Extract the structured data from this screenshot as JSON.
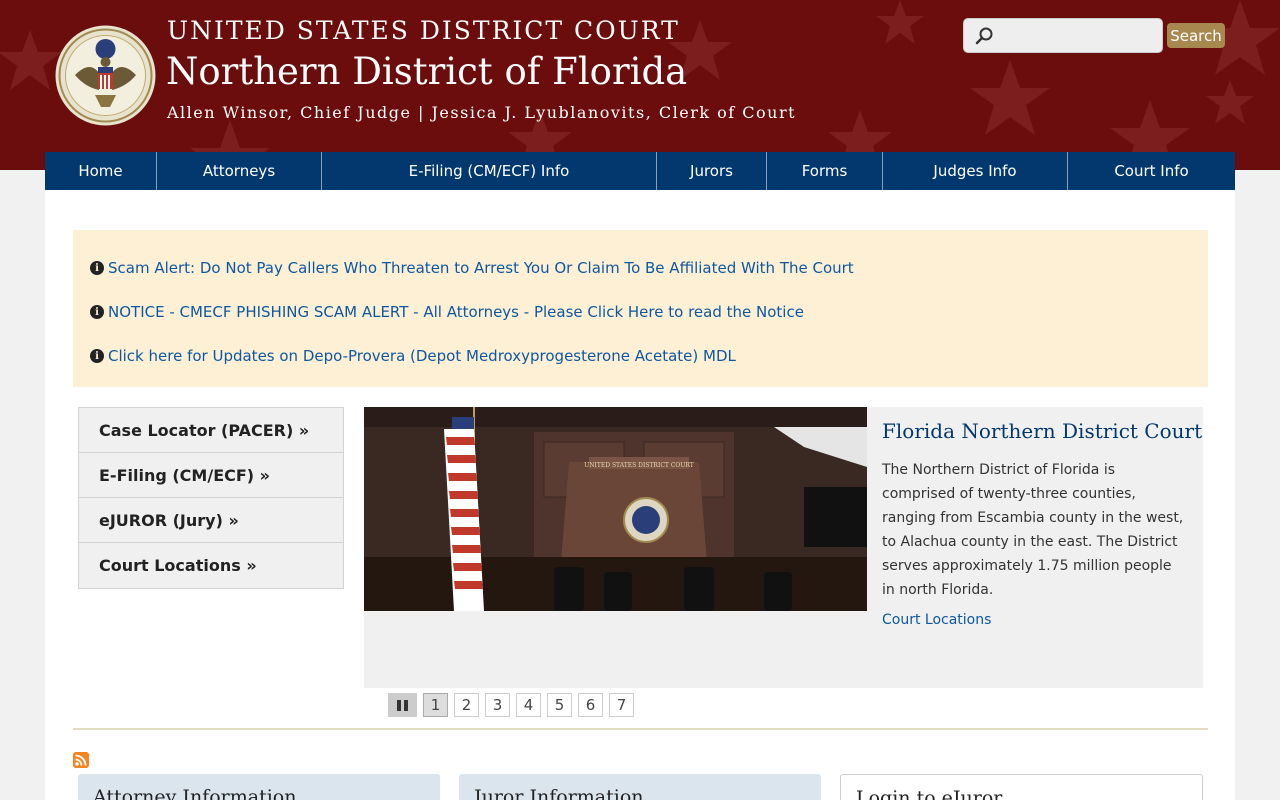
{
  "header": {
    "line1": "UNITED STATES DISTRICT COURT",
    "line2": "Northern District of Florida",
    "line3": "Allen Winsor, Chief Judge | Jessica J. Lyublanovits, Clerk of Court",
    "search_placeholder": "",
    "search_button": "Search"
  },
  "nav": {
    "items": [
      {
        "label": "Home"
      },
      {
        "label": "Attorneys"
      },
      {
        "label": "E-Filing (CM/ECF) Info"
      },
      {
        "label": "Jurors"
      },
      {
        "label": "Forms"
      },
      {
        "label": "Judges Info"
      },
      {
        "label": "Court Info"
      }
    ]
  },
  "alerts": [
    "Scam Alert: Do Not Pay Callers Who Threaten to Arrest You Or Claim To Be Affiliated With The Court",
    "NOTICE - CMECF PHISHING SCAM ALERT - All Attorneys - Please Click Here to read the Notice",
    "Click here for Updates on Depo-Provera (Depot Medroxyprogesterone Acetate) MDL"
  ],
  "quick_links": [
    "Case Locator (PACER) »",
    "E-Filing (CM/ECF) »",
    "eJUROR (Jury) »",
    "Court Locations »"
  ],
  "slide": {
    "title": "Florida Northern District Court",
    "text": "The Northern District of Florida is comprised of twenty-three counties, ranging from Escambia county in the west, to Alachua county in the east.  The District serves approximately 1.75 million people in north Florida.",
    "link": "Court Locations",
    "courtroom_sign": "UNITED STATES DISTRICT COURT"
  },
  "pager": {
    "pages": [
      "1",
      "2",
      "3",
      "4",
      "5",
      "6",
      "7"
    ],
    "active": "1"
  },
  "cards": [
    "Attorney Information",
    "Juror Information",
    "Login to eJuror"
  ],
  "colors": {
    "header_bg": "#6b0d0d",
    "nav_bg": "#02386e",
    "alert_bg": "#fdf0d5",
    "link": "#0f58a1",
    "search_button": "#a7894f"
  }
}
